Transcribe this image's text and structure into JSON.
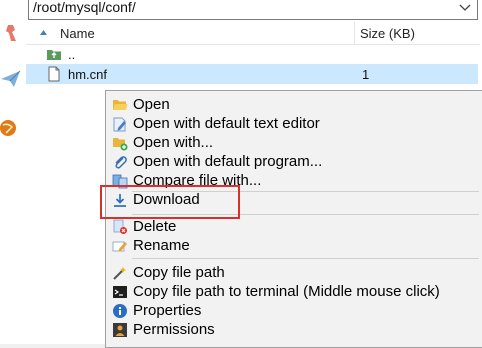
{
  "path": {
    "value": "/root/mysql/conf/"
  },
  "columns": {
    "name": "Name",
    "size": "Size (KB)"
  },
  "files": [
    {
      "name": "..",
      "size": "",
      "icon": "folder-up-icon"
    },
    {
      "name": "hm.cnf",
      "size": "1",
      "icon": "file-icon"
    }
  ],
  "menu": {
    "items": [
      {
        "label": "Open",
        "icon": "folder-open-icon"
      },
      {
        "label": "Open with default text editor",
        "icon": "text-editor-icon"
      },
      {
        "label": "Open with...",
        "icon": "open-with-icon"
      },
      {
        "label": "Open with default program...",
        "icon": "paperclip-icon"
      },
      {
        "label": "Compare file with...",
        "icon": "compare-icon"
      },
      {
        "label": "Download",
        "icon": "download-icon"
      },
      {
        "label": "Delete",
        "icon": "delete-icon"
      },
      {
        "label": "Rename",
        "icon": "rename-icon"
      },
      {
        "label": "Copy file path",
        "icon": "magic-wand-icon"
      },
      {
        "label": "Copy file path to terminal (Middle mouse click)",
        "icon": "terminal-icon"
      },
      {
        "label": "Properties",
        "icon": "info-icon"
      },
      {
        "label": "Permissions",
        "icon": "permissions-icon"
      }
    ]
  },
  "colors": {
    "selection": "#cce8ff",
    "highlight": "#d9302c",
    "menu_bg": "#f2f2f2"
  }
}
